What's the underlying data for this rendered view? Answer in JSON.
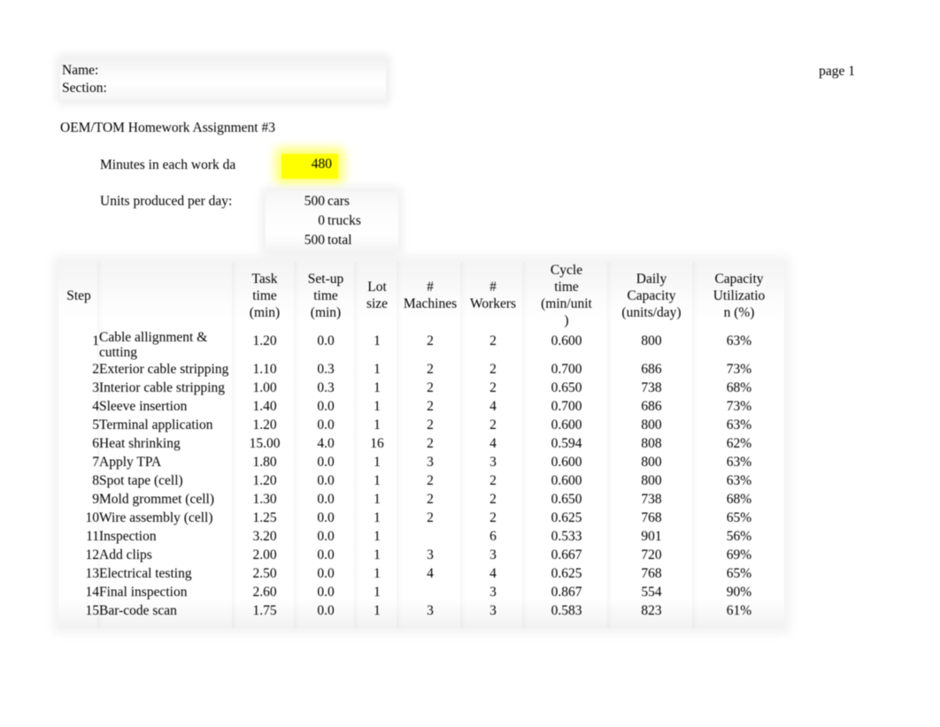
{
  "header": {
    "name_label": "Name:",
    "section_label": "Section:",
    "page_label": "page 1",
    "assignment_title": "OEM/TOM Homework Assignment #3"
  },
  "params": {
    "minutes_label": "Minutes in each work da",
    "minutes_value": "480",
    "minutes_highlight_color": "#ffff00",
    "units_label": "Units produced per day:",
    "units": [
      {
        "value": "500",
        "unit": "cars"
      },
      {
        "value": "0",
        "unit": "trucks"
      },
      {
        "value": "500",
        "unit": "total"
      }
    ]
  },
  "table": {
    "columns": [
      "Step",
      "",
      "Task time (min)",
      "Set-up time (min)",
      "Lot size",
      "# Machines",
      "# Workers",
      "Cycle time (min/unit )",
      "Daily Capacity (units/day)",
      "Capacity Utilizatio n (%)"
    ],
    "headers": {
      "step": "Step",
      "description": "",
      "task_time": [
        "Task",
        "time",
        "(min)"
      ],
      "setup_time": [
        "Set-up",
        "time",
        "(min)"
      ],
      "lot_size": [
        "Lot",
        "size"
      ],
      "machines": [
        "#",
        "Machines"
      ],
      "workers": [
        "#",
        "Workers"
      ],
      "cycle_time": [
        "Cycle",
        "time",
        "(min/unit",
        ")"
      ],
      "daily_capacity": [
        "Daily",
        "Capacity",
        "(units/day)"
      ],
      "capacity_utilization": [
        "Capacity",
        "Utilizatio",
        "n (%)"
      ]
    },
    "rows": [
      {
        "step": "1",
        "name": "Cable allignment & cutting",
        "task": "1.20",
        "setup": "0.0",
        "lot": "1",
        "machines": "2",
        "workers": "2",
        "cycle": "0.600",
        "daily": "800",
        "util": "63%"
      },
      {
        "step": "2",
        "name": "Exterior cable stripping",
        "task": "1.10",
        "setup": "0.3",
        "lot": "1",
        "machines": "2",
        "workers": "2",
        "cycle": "0.700",
        "daily": "686",
        "util": "73%"
      },
      {
        "step": "3",
        "name": "Interior cable stripping",
        "task": "1.00",
        "setup": "0.3",
        "lot": "1",
        "machines": "2",
        "workers": "2",
        "cycle": "0.650",
        "daily": "738",
        "util": "68%"
      },
      {
        "step": "4",
        "name": "Sleeve insertion",
        "task": "1.40",
        "setup": "0.0",
        "lot": "1",
        "machines": "2",
        "workers": "4",
        "cycle": "0.700",
        "daily": "686",
        "util": "73%"
      },
      {
        "step": "5",
        "name": "Terminal application",
        "task": "1.20",
        "setup": "0.0",
        "lot": "1",
        "machines": "2",
        "workers": "2",
        "cycle": "0.600",
        "daily": "800",
        "util": "63%"
      },
      {
        "step": "6",
        "name": "Heat shrinking",
        "task": "15.00",
        "setup": "4.0",
        "lot": "16",
        "machines": "2",
        "workers": "4",
        "cycle": "0.594",
        "daily": "808",
        "util": "62%"
      },
      {
        "step": "7",
        "name": "Apply TPA",
        "task": "1.80",
        "setup": "0.0",
        "lot": "1",
        "machines": "3",
        "workers": "3",
        "cycle": "0.600",
        "daily": "800",
        "util": "63%"
      },
      {
        "step": "8",
        "name": "Spot tape (cell)",
        "task": "1.20",
        "setup": "0.0",
        "lot": "1",
        "machines": "2",
        "workers": "2",
        "cycle": "0.600",
        "daily": "800",
        "util": "63%"
      },
      {
        "step": "9",
        "name": "Mold grommet (cell)",
        "task": "1.30",
        "setup": "0.0",
        "lot": "1",
        "machines": "2",
        "workers": "2",
        "cycle": "0.650",
        "daily": "738",
        "util": "68%"
      },
      {
        "step": "10",
        "name": "Wire assembly (cell)",
        "task": "1.25",
        "setup": "0.0",
        "lot": "1",
        "machines": "2",
        "workers": "2",
        "cycle": "0.625",
        "daily": "768",
        "util": "65%"
      },
      {
        "step": "11",
        "name": "Inspection",
        "task": "3.20",
        "setup": "0.0",
        "lot": "1",
        "machines": "",
        "workers": "6",
        "cycle": "0.533",
        "daily": "901",
        "util": "56%"
      },
      {
        "step": "12",
        "name": "Add clips",
        "task": "2.00",
        "setup": "0.0",
        "lot": "1",
        "machines": "3",
        "workers": "3",
        "cycle": "0.667",
        "daily": "720",
        "util": "69%"
      },
      {
        "step": "13",
        "name": "Electrical testing",
        "task": "2.50",
        "setup": "0.0",
        "lot": "1",
        "machines": "4",
        "workers": "4",
        "cycle": "0.625",
        "daily": "768",
        "util": "65%"
      },
      {
        "step": "14",
        "name": "Final inspection",
        "task": "2.60",
        "setup": "0.0",
        "lot": "1",
        "machines": "",
        "workers": "3",
        "cycle": "0.867",
        "daily": "554",
        "util": "90%"
      },
      {
        "step": "15",
        "name": "Bar-code scan",
        "task": "1.75",
        "setup": "0.0",
        "lot": "1",
        "machines": "3",
        "workers": "3",
        "cycle": "0.583",
        "daily": "823",
        "util": "61%"
      }
    ]
  }
}
